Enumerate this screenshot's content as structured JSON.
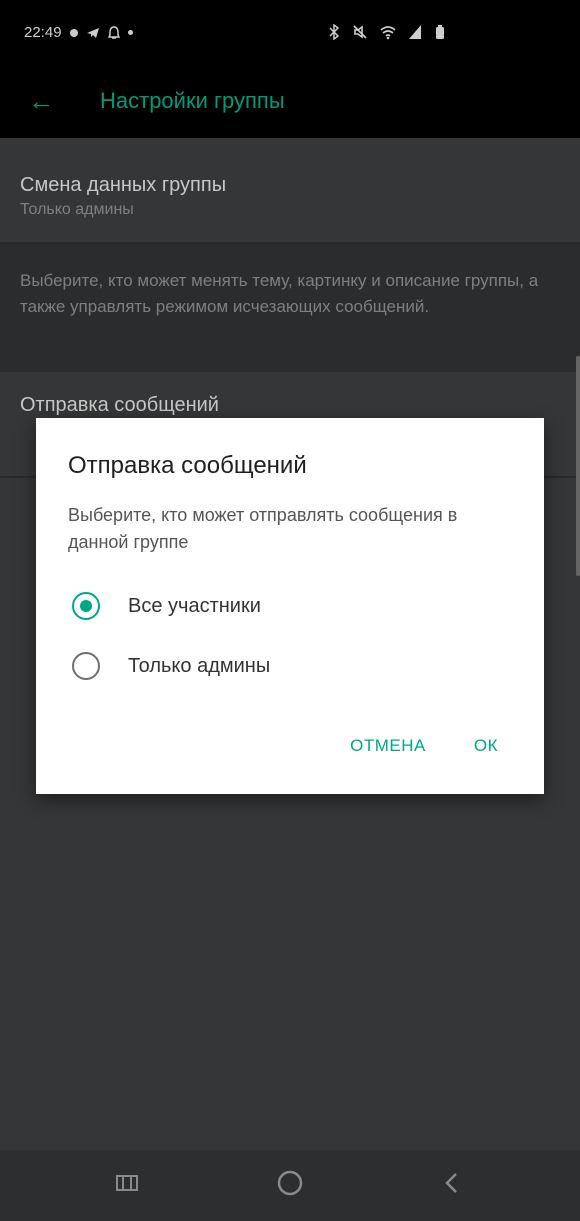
{
  "status_bar": {
    "time": "22:49",
    "icons": [
      "dot-icon",
      "telegram-icon",
      "notification-icon",
      "small-dot-icon"
    ],
    "right_icons": [
      "bluetooth-icon",
      "mute-icon",
      "wifi-icon",
      "signal-icon",
      "battery-icon"
    ]
  },
  "toolbar": {
    "title": "Настройки группы",
    "back_icon": "arrow-left-icon"
  },
  "settings": {
    "group_data_title": "Смена данных группы",
    "group_data_subtitle": "Только админы",
    "group_data_description": "Выберите, кто может менять тему, картинку и описание группы, а также управлять режимом исчезающих сообщений.",
    "send_messages_title": "Отправка сообщений"
  },
  "dialog": {
    "title": "Отправка сообщений",
    "description": "Выберите, кто может отправлять сообщения в данной группе",
    "options": [
      {
        "label": "Все участники",
        "selected": true
      },
      {
        "label": "Только админы",
        "selected": false
      }
    ],
    "cancel_label": "ОТМЕНА",
    "ok_label": "ОК"
  },
  "nav_bar": {
    "recent_icon": "recent-apps-icon",
    "home_icon": "home-icon",
    "back_icon": "back-icon"
  },
  "colors": {
    "accent": "#00a884",
    "background": "#3a3b3c",
    "dialog": "#ffffff"
  }
}
